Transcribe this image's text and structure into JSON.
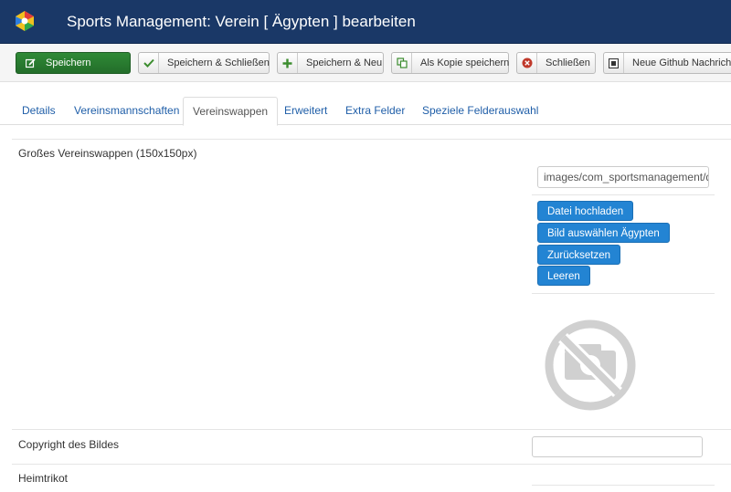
{
  "header": {
    "title": "Sports Management: Verein [ Ägypten ] bearbeiten"
  },
  "toolbar": {
    "save": "Speichern",
    "save_close": "Speichern & Schließen",
    "save_new": "Speichern & Neu",
    "save_copy": "Als Kopie speichern",
    "close": "Schließen",
    "github": "Neue Github Nachricht"
  },
  "tabs": [
    {
      "label": "Details"
    },
    {
      "label": "Vereinsmannschaften"
    },
    {
      "label": "Vereinswappen"
    },
    {
      "label": "Erweitert"
    },
    {
      "label": "Extra Felder"
    },
    {
      "label": "Speziele Felderauswahl"
    }
  ],
  "active_tab": "Vereinswappen",
  "form": {
    "logo_label": "Großes Vereinswappen (150x150px)",
    "logo_path": "images/com_sportsmanagement/da",
    "upload": "Datei hochladen",
    "select_image": "Bild auswählen Ägypten",
    "reset": "Zurücksetzen",
    "clear": "Leeren",
    "copyright_label": "Copyright des Bildes",
    "copyright_value": "",
    "home_jersey_label": "Heimtrikot"
  },
  "colors": {
    "header_bg": "#1a3867",
    "save_green": "#2f8a36",
    "primary_blue": "#2384d3",
    "link_blue": "#1f5ea8"
  }
}
